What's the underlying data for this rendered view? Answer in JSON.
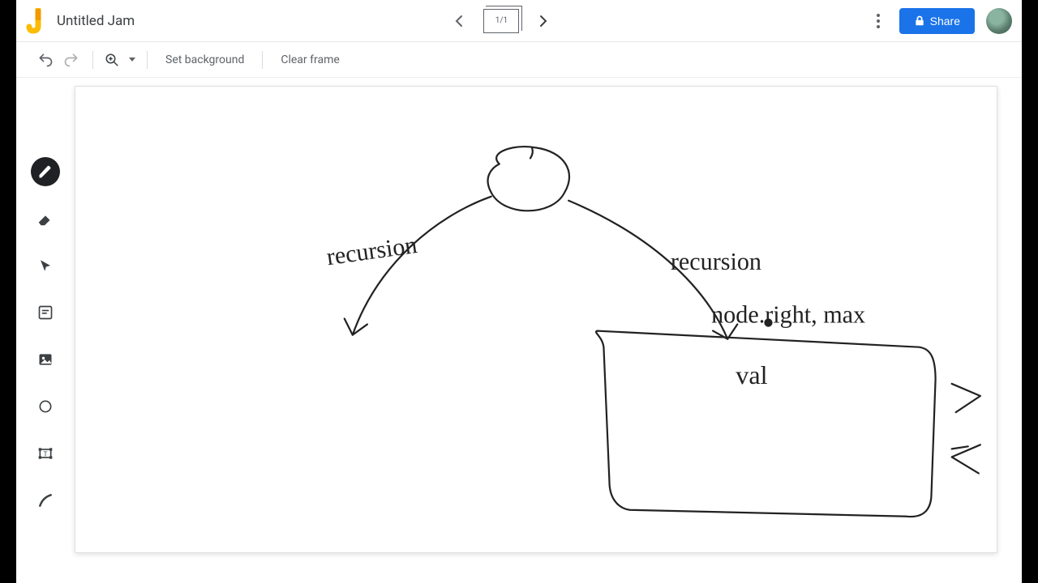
{
  "header": {
    "title": "Untitled Jam",
    "frame_indicator": "1/1",
    "share_label": "Share"
  },
  "toolbar": {
    "set_background": "Set background",
    "clear_frame": "Clear frame"
  },
  "tools": {
    "pen": "pen",
    "eraser": "eraser",
    "select": "select",
    "sticky": "sticky-note",
    "image": "image",
    "shape": "shape",
    "textbox": "textbox",
    "laser": "laser"
  },
  "sketch": {
    "label_left": "recursion",
    "label_right_1": "recursion",
    "label_right_2": "node.right, max",
    "label_box": "val"
  },
  "colors": {
    "accent": "#1a73e8",
    "ink": "#222222"
  }
}
